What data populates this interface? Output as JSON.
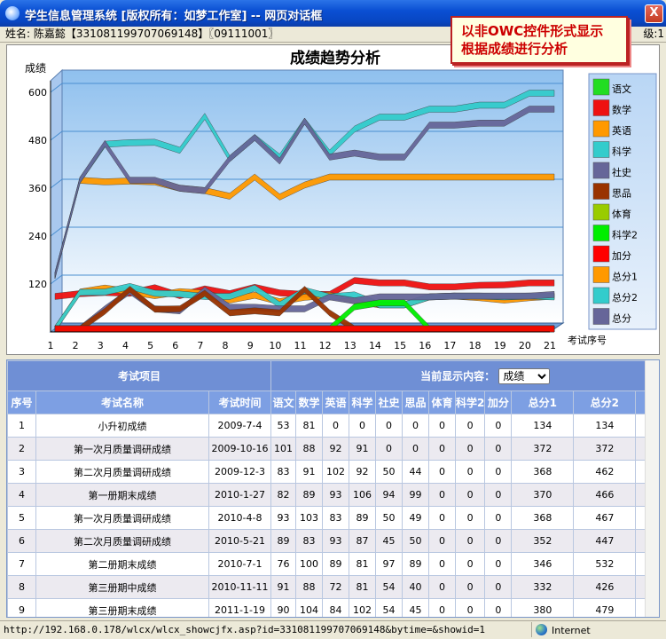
{
  "window": {
    "title": "学生信息管理系统 [版权所有：如梦工作室] -- 网页对话框",
    "close_label": "X"
  },
  "infobar": {
    "left": "姓名: 陈嘉懿【331081199707069148】〖09111001〗",
    "right": "级:1"
  },
  "callout": {
    "line1": "以非OWC控件形式显示",
    "line2": "根据成绩进行分析"
  },
  "chart_data": {
    "type": "line",
    "title": "成绩趋势分析",
    "ylabel": "成绩",
    "xlabel": "考试序号",
    "x": [
      1,
      2,
      3,
      4,
      5,
      6,
      7,
      8,
      9,
      10,
      11,
      12,
      13,
      14,
      15,
      16,
      17,
      18,
      19,
      20,
      21
    ],
    "ylim": [
      0,
      620
    ],
    "yticks": [
      120,
      240,
      360,
      480,
      600
    ],
    "grid": true,
    "legend_position": "right",
    "series": [
      {
        "name": "语文",
        "color": "#22dd22",
        "values": [
          0,
          0,
          0,
          0,
          0,
          0,
          0,
          0,
          0,
          0,
          0,
          0,
          0,
          0,
          0,
          0,
          0,
          0,
          0,
          0,
          0
        ]
      },
      {
        "name": "数学",
        "color": "#ee1111",
        "values": [
          81,
          88,
          91,
          89,
          103,
          83,
          100,
          88,
          104,
          90,
          86,
          86,
          121,
          115,
          115,
          105,
          105,
          109,
          110,
          115,
          115
        ]
      },
      {
        "name": "英语",
        "color": "#ff9900",
        "values": [
          0,
          92,
          102,
          93,
          83,
          93,
          89,
          72,
          84,
          68,
          79,
          84,
          70,
          60,
          60,
          80,
          82,
          78,
          72,
          78,
          82
        ]
      },
      {
        "name": "科学",
        "color": "#33cccc",
        "values": [
          0,
          91,
          92,
          106,
          89,
          87,
          81,
          81,
          102,
          60,
          96,
          80,
          85,
          60,
          60,
          80,
          82,
          82,
          80,
          82,
          80
        ]
      },
      {
        "name": "社史",
        "color": "#666699",
        "values": [
          0,
          0,
          50,
          94,
          50,
          45,
          97,
          54,
          54,
          50,
          50,
          80,
          70,
          80,
          80,
          80,
          82,
          82,
          82,
          82,
          86
        ]
      },
      {
        "name": "思品",
        "color": "#993300",
        "values": [
          0,
          0,
          44,
          99,
          49,
          50,
          89,
          40,
          45,
          40,
          99,
          40,
          0,
          0,
          0,
          0,
          0,
          0,
          0,
          0,
          0
        ]
      },
      {
        "name": "体育",
        "color": "#99cc00",
        "values": [
          0,
          0,
          0,
          0,
          0,
          0,
          0,
          0,
          0,
          0,
          0,
          0,
          0,
          0,
          0,
          0,
          0,
          0,
          0,
          0,
          0
        ]
      },
      {
        "name": "科学2",
        "color": "#00ee00",
        "values": [
          0,
          0,
          0,
          0,
          0,
          0,
          0,
          0,
          0,
          0,
          0,
          0,
          55,
          65,
          65,
          0,
          0,
          0,
          0,
          0,
          0
        ]
      },
      {
        "name": "加分",
        "color": "#ff0000",
        "values": [
          0,
          0,
          0,
          0,
          0,
          0,
          0,
          0,
          0,
          0,
          0,
          0,
          0,
          0,
          0,
          0,
          0,
          0,
          0,
          0,
          0
        ]
      },
      {
        "name": "总分1",
        "color": "#ff9900",
        "values": [
          134,
          372,
          368,
          370,
          368,
          352,
          346,
          332,
          380,
          330,
          360,
          380,
          380,
          380,
          380,
          380,
          380,
          380,
          380,
          380,
          380
        ]
      },
      {
        "name": "总分2",
        "color": "#33cccc",
        "values": [
          134,
          372,
          462,
          466,
          467,
          447,
          532,
          426,
          479,
          430,
          520,
          440,
          500,
          530,
          530,
          550,
          550,
          560,
          560,
          590,
          590
        ]
      },
      {
        "name": "总分",
        "color": "#666699",
        "values": [
          134,
          372,
          464,
          372,
          372,
          352,
          346,
          426,
          479,
          420,
          520,
          430,
          440,
          430,
          430,
          510,
          510,
          515,
          515,
          550,
          550
        ]
      }
    ]
  },
  "table": {
    "group_headers": {
      "exam_item": "考试项目",
      "current_label": "当前显示内容：",
      "current_value": "成绩"
    },
    "columns": [
      "序号",
      "考试名称",
      "考试时间",
      "语文",
      "数学",
      "英语",
      "科学",
      "社史",
      "思品",
      "体育",
      "科学2",
      "加分",
      "总分1",
      "总分2"
    ],
    "rows": [
      [
        "1",
        "小升初成绩",
        "2009-7-4",
        "53",
        "81",
        "0",
        "0",
        "0",
        "0",
        "0",
        "0",
        "0",
        "134",
        "134"
      ],
      [
        "2",
        "第一次月质量调研成绩",
        "2009-10-16",
        "101",
        "88",
        "92",
        "91",
        "0",
        "0",
        "0",
        "0",
        "0",
        "372",
        "372"
      ],
      [
        "3",
        "第二次月质量调研成绩",
        "2009-12-3",
        "83",
        "91",
        "102",
        "92",
        "50",
        "44",
        "0",
        "0",
        "0",
        "368",
        "462"
      ],
      [
        "4",
        "第一册期末成绩",
        "2010-1-27",
        "82",
        "89",
        "93",
        "106",
        "94",
        "99",
        "0",
        "0",
        "0",
        "370",
        "466"
      ],
      [
        "5",
        "第一次月质量调研成绩",
        "2010-4-8",
        "93",
        "103",
        "83",
        "89",
        "50",
        "49",
        "0",
        "0",
        "0",
        "368",
        "467"
      ],
      [
        "6",
        "第二次月质量调研成绩",
        "2010-5-21",
        "89",
        "83",
        "93",
        "87",
        "45",
        "50",
        "0",
        "0",
        "0",
        "352",
        "447"
      ],
      [
        "7",
        "第二册期末成绩",
        "2010-7-1",
        "76",
        "100",
        "89",
        "81",
        "97",
        "89",
        "0",
        "0",
        "0",
        "346",
        "532"
      ],
      [
        "8",
        "第三册期中成绩",
        "2010-11-11",
        "91",
        "88",
        "72",
        "81",
        "54",
        "40",
        "0",
        "0",
        "0",
        "332",
        "426"
      ],
      [
        "9",
        "第三册期末成绩",
        "2011-1-19",
        "90",
        "104",
        "84",
        "102",
        "54",
        "45",
        "0",
        "0",
        "0",
        "380",
        "479"
      ]
    ]
  },
  "statusbar": {
    "url": "http://192.168.0.178/wlcx/wlcx_showcjfx.asp?id=331081199707069148&bytime=&showid=1",
    "zone": "Internet"
  }
}
